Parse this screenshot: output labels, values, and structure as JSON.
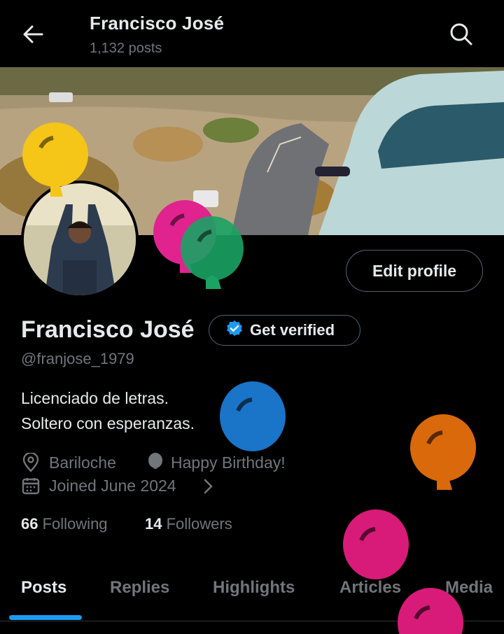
{
  "header": {
    "title": "Francisco José",
    "posts_count": "1,132 posts"
  },
  "profile": {
    "name": "Francisco José",
    "get_verified_label": "Get verified",
    "edit_profile_label": "Edit profile",
    "handle": "@franjose_1979",
    "bio_line1": "Licenciado de letras.",
    "bio_line2": "Soltero con esperanzas.",
    "location": "Bariloche",
    "birthday": "Happy Birthday!",
    "joined": "Joined June 2024",
    "following_count": "66",
    "following_label": "Following",
    "followers_count": "14",
    "followers_label": "Followers"
  },
  "tabs": [
    {
      "label": "Posts"
    },
    {
      "label": "Replies"
    },
    {
      "label": "Highlights"
    },
    {
      "label": "Articles"
    },
    {
      "label": "Media"
    }
  ],
  "icons": {
    "back": "arrow-left-icon",
    "search": "search-icon",
    "verified": "verified-badge-icon",
    "location": "location-pin-icon",
    "birthday": "balloon-icon",
    "calendar": "calendar-icon",
    "chevron": "chevron-right-icon"
  },
  "colors": {
    "background": "#000000",
    "text": "#e7e9ea",
    "muted": "#71767b",
    "accent": "#1d9bf0",
    "balloons": [
      "#f5c518",
      "#e0238f",
      "#1aa364",
      "#1a74c8",
      "#d9690a",
      "#d81b78"
    ]
  }
}
